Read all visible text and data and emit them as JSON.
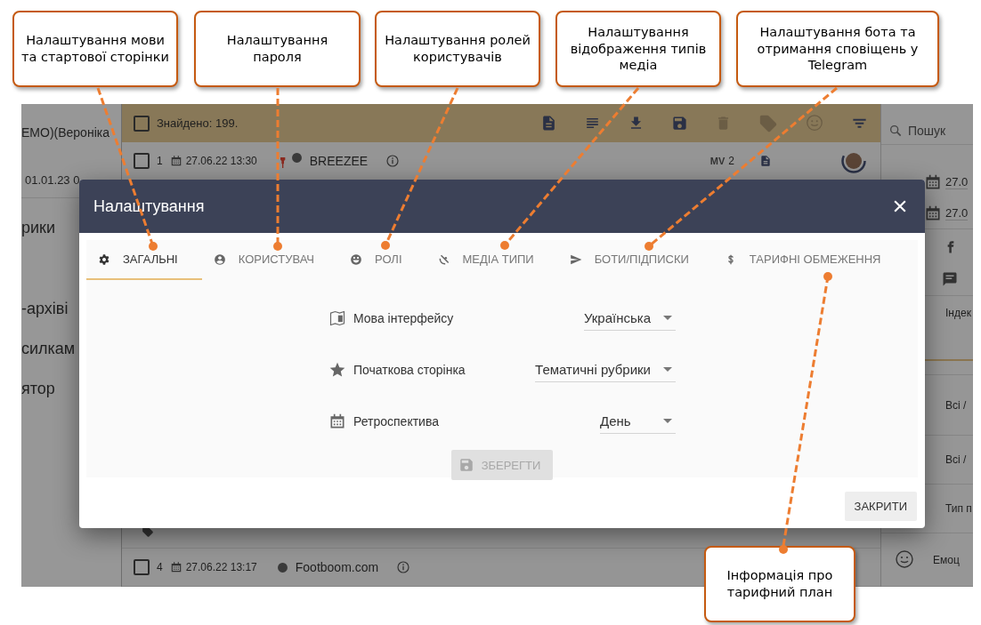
{
  "app": {
    "left_panel": {
      "user": "ЕМО)(Вероніка",
      "date": "01.01.23 0",
      "menu": [
        "рики",
        "-архіві",
        "силкам",
        "ятор"
      ]
    },
    "toolbar": {
      "checked": false,
      "found": "Знайдено: 199."
    },
    "rows": [
      {
        "checked": false,
        "number": "1",
        "date": "27.06.22 13:30",
        "source": "BREEZEE",
        "badge": "MV",
        "count": "2"
      },
      {
        "checked": false,
        "number": "4",
        "date": "27.06.22 13:17",
        "source": "Footboom.com"
      }
    ],
    "right_panel": {
      "search": {
        "placeholder": "Пошук"
      },
      "dates": [
        "27.0",
        "27.0"
      ],
      "filters": [
        "Індек",
        "Всі /",
        "Всі /",
        "Тип п",
        "Емоц"
      ]
    }
  },
  "dialog": {
    "title": "Налаштування",
    "tabs": [
      {
        "label": "ЗАГАЛЬНІ",
        "selected": true
      },
      {
        "label": "КОРИСТУВАЧ",
        "selected": false
      },
      {
        "label": "РОЛІ",
        "selected": false
      },
      {
        "label": "МЕДІА ТИПИ",
        "selected": false
      },
      {
        "label": "БОТИ/ПІДПИСКИ",
        "selected": false
      },
      {
        "label": "ТАРИФНІ ОБМЕЖЕННЯ",
        "selected": false
      }
    ],
    "fields": [
      {
        "label": "Мова інтерфейсу",
        "value": "Українська"
      },
      {
        "label": "Початкова сторінка",
        "value": "Тематичні рубрики"
      },
      {
        "label": "Ретроспектива",
        "value": "День"
      }
    ],
    "save_button": {
      "label": "ЗБЕРЕГТИ",
      "disabled": true
    },
    "close_button": "ЗАКРИТИ"
  },
  "callouts": [
    {
      "text": "Налаштування мови та стартової сторінки"
    },
    {
      "text": "Налаштування пароля"
    },
    {
      "text": "Налаштування ролей користувачів"
    },
    {
      "text": "Налаштування відображення типів медіа"
    },
    {
      "text": "Налаштування бота та отримання сповіщень у Telegram"
    },
    {
      "text": "Інформація про тарифний план"
    }
  ]
}
